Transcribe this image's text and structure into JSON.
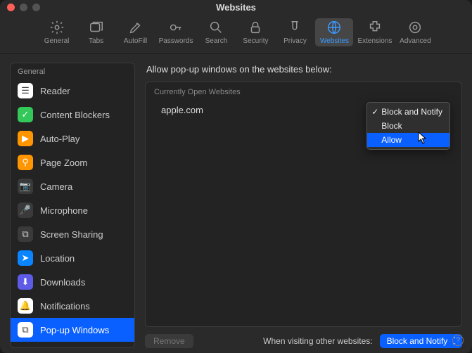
{
  "window": {
    "title": "Websites"
  },
  "toolbar": [
    {
      "id": "general",
      "label": "General"
    },
    {
      "id": "tabs",
      "label": "Tabs"
    },
    {
      "id": "autofill",
      "label": "AutoFill"
    },
    {
      "id": "passwords",
      "label": "Passwords"
    },
    {
      "id": "search",
      "label": "Search"
    },
    {
      "id": "security",
      "label": "Security"
    },
    {
      "id": "privacy",
      "label": "Privacy"
    },
    {
      "id": "websites",
      "label": "Websites",
      "active": true
    },
    {
      "id": "extensions",
      "label": "Extensions"
    },
    {
      "id": "advanced",
      "label": "Advanced"
    }
  ],
  "sidebar": {
    "header": "General",
    "items": [
      {
        "label": "Reader",
        "icon_bg": "#ffffff",
        "glyph": "☰",
        "glyph_color": "#444"
      },
      {
        "label": "Content Blockers",
        "icon_bg": "#34c759",
        "glyph": "✓",
        "glyph_color": "#fff"
      },
      {
        "label": "Auto-Play",
        "icon_bg": "#ff9500",
        "glyph": "▶",
        "glyph_color": "#fff"
      },
      {
        "label": "Page Zoom",
        "icon_bg": "#ff9500",
        "glyph": "⚲",
        "glyph_color": "#fff"
      },
      {
        "label": "Camera",
        "icon_bg": "#3a3a3a",
        "glyph": "📷",
        "glyph_color": "#ccc"
      },
      {
        "label": "Microphone",
        "icon_bg": "#3a3a3a",
        "glyph": "🎤",
        "glyph_color": "#ccc"
      },
      {
        "label": "Screen Sharing",
        "icon_bg": "#3a3a3a",
        "glyph": "⧉",
        "glyph_color": "#ccc"
      },
      {
        "label": "Location",
        "icon_bg": "#0a84ff",
        "glyph": "➤",
        "glyph_color": "#fff"
      },
      {
        "label": "Downloads",
        "icon_bg": "#5e5ce6",
        "glyph": "⬇",
        "glyph_color": "#fff"
      },
      {
        "label": "Notifications",
        "icon_bg": "#ffffff",
        "glyph": "🔔",
        "glyph_color": "#ff3b30"
      },
      {
        "label": "Pop-up Windows",
        "icon_bg": "#ffffff",
        "glyph": "⧉",
        "glyph_color": "#444",
        "selected": true
      }
    ]
  },
  "main": {
    "heading": "Allow pop-up windows on the websites below:",
    "section_header": "Currently Open Websites",
    "sites": [
      {
        "domain": "apple.com"
      }
    ],
    "remove_label": "Remove",
    "footer_label": "When visiting other websites:",
    "footer_value": "Block and Notify"
  },
  "popup": {
    "options": [
      {
        "label": "Block and Notify",
        "checked": true
      },
      {
        "label": "Block"
      },
      {
        "label": "Allow",
        "hover": true
      }
    ]
  },
  "colors": {
    "accent": "#0a60ff"
  }
}
